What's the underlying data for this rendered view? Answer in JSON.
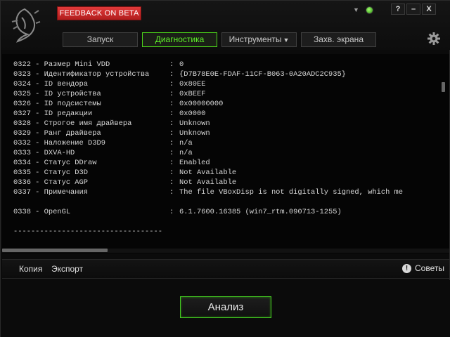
{
  "header": {
    "feedback_label": "FEEDBACK ON BETA",
    "status_caret": "▼",
    "window_buttons": [
      "?",
      "–",
      "X"
    ]
  },
  "tabs": [
    {
      "label": "Запуск",
      "active": false
    },
    {
      "label": "Диагностика",
      "active": true
    },
    {
      "label": "Инструменты",
      "active": false,
      "caret": "▼"
    },
    {
      "label": "Захв. экрана",
      "active": false
    }
  ],
  "log": {
    "lines": [
      {
        "key": "0322 - Размер Mini VDD",
        "sep": ":",
        "value": "0"
      },
      {
        "key": "0323 - Идентификатор устройства",
        "sep": ":",
        "value": "{D7B78E0E-FDAF-11CF-B063-0A20ADC2C935}"
      },
      {
        "key": "0324 - ID вендора",
        "sep": ":",
        "value": "0x80EE"
      },
      {
        "key": "0325 - ID устройства",
        "sep": ":",
        "value": "0xBEEF"
      },
      {
        "key": "0326 - ID подсистемы",
        "sep": ":",
        "value": "0x00000000"
      },
      {
        "key": "0327 - ID редакции",
        "sep": ":",
        "value": "0x0000"
      },
      {
        "key": "0328 - Строгое имя драйвера",
        "sep": ":",
        "value": "Unknown"
      },
      {
        "key": "0329 - Ранг драйвера",
        "sep": ":",
        "value": "Unknown"
      },
      {
        "key": "0332 - Наложение D3D9",
        "sep": ":",
        "value": "n/a"
      },
      {
        "key": "0333 - DXVA-HD",
        "sep": ":",
        "value": "n/a"
      },
      {
        "key": "0334 - Статус DDraw",
        "sep": ":",
        "value": "Enabled"
      },
      {
        "key": "0335 - Статус D3D",
        "sep": ":",
        "value": "Not Available"
      },
      {
        "key": "0336 - Статус AGP",
        "sep": ":",
        "value": "Not Available"
      },
      {
        "key": "0337 - Примечания",
        "sep": ":",
        "value": "The file VBoxDisp is not digitally signed, which me"
      },
      {
        "key": "",
        "sep": "",
        "value": ""
      },
      {
        "key": "0338 - OpenGL",
        "sep": ":",
        "value": "6.1.7600.16385 (win7_rtm.090713-1255)"
      },
      {
        "key": "",
        "sep": "",
        "value": ""
      },
      {
        "key": "----------------------------------",
        "sep": "",
        "value": ""
      }
    ]
  },
  "toolbar": {
    "copy_label": "Копия",
    "export_label": "Экспорт",
    "tips_label": "Советы",
    "tips_icon": "!"
  },
  "footer": {
    "analyze_label": "Анализ"
  },
  "colors": {
    "accent_green": "#4cd41a",
    "feedback_red": "#c82626",
    "background": "#0b0b0b"
  },
  "icons": {
    "logo": "razer-snake-logo",
    "settings": "gear-icon",
    "status": "status-dot-icon"
  }
}
